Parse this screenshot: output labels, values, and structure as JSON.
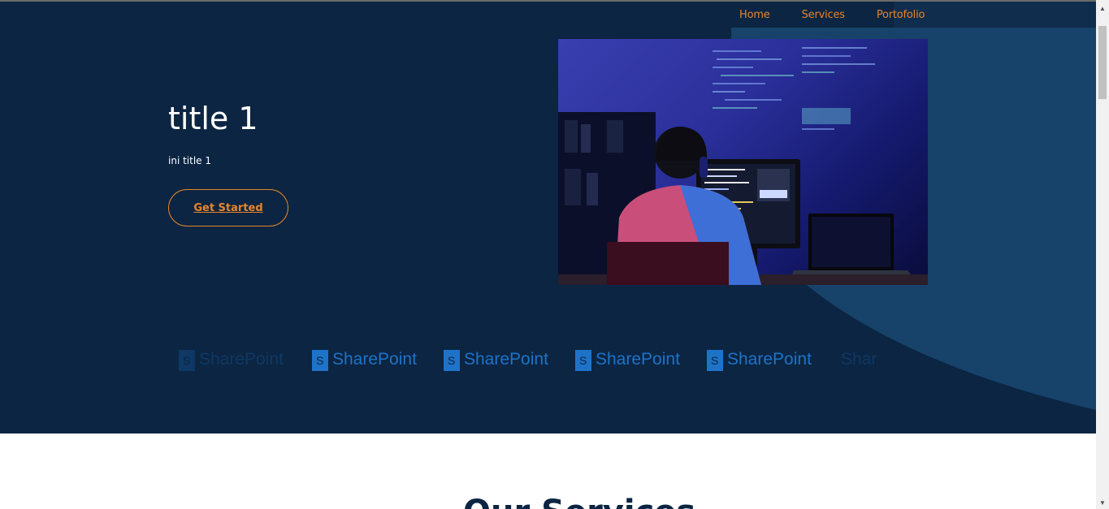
{
  "nav": {
    "items": [
      {
        "label": "Home"
      },
      {
        "label": "Services"
      },
      {
        "label": "Portofolio"
      }
    ]
  },
  "hero": {
    "title": "title 1",
    "subtitle": "ini title 1",
    "cta_label": "Get Started"
  },
  "logos": {
    "items": [
      {
        "text": "SharePoint"
      },
      {
        "text": "SharePoint"
      },
      {
        "text": "SharePoint"
      },
      {
        "text": "SharePoint"
      },
      {
        "text": "SharePoint"
      },
      {
        "text": "SharePoint"
      }
    ]
  },
  "services": {
    "heading": "Our Services"
  },
  "colors": {
    "background": "#0b2542",
    "accent": "#e8852a",
    "logo_blue": "#1e73c9"
  }
}
